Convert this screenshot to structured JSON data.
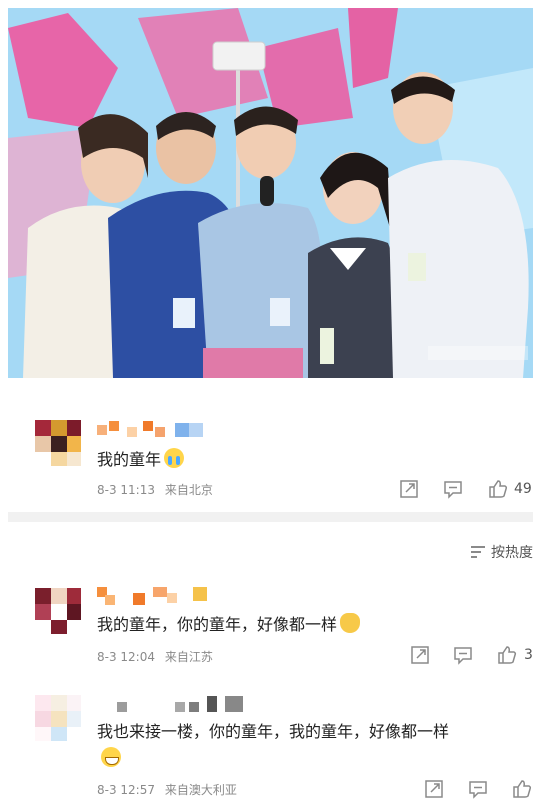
{
  "comments": [
    {
      "text": "我的童年",
      "emoji": "crying-face-icon",
      "date": "8-3 11:13",
      "location": "来自北京",
      "likes": "49"
    },
    {
      "text": "我的童年，你的童年，好像都一样",
      "emoji": "cat-face-icon",
      "date": "8-3 12:04",
      "location": "来自江苏",
      "likes": "3"
    },
    {
      "text": "我也来接一楼，你的童年，我的童年，好像都一样",
      "emoji": "grinning-face-icon",
      "date": "8-3 12:57",
      "location": "来自澳大利亚",
      "likes": ""
    }
  ],
  "sort": {
    "label": "按热度",
    "icon": "sort-icon"
  },
  "colors": {
    "meta_gray": "#8a8a8a",
    "divider": "#f1f1f1",
    "hero_pink": "#f2509a"
  }
}
